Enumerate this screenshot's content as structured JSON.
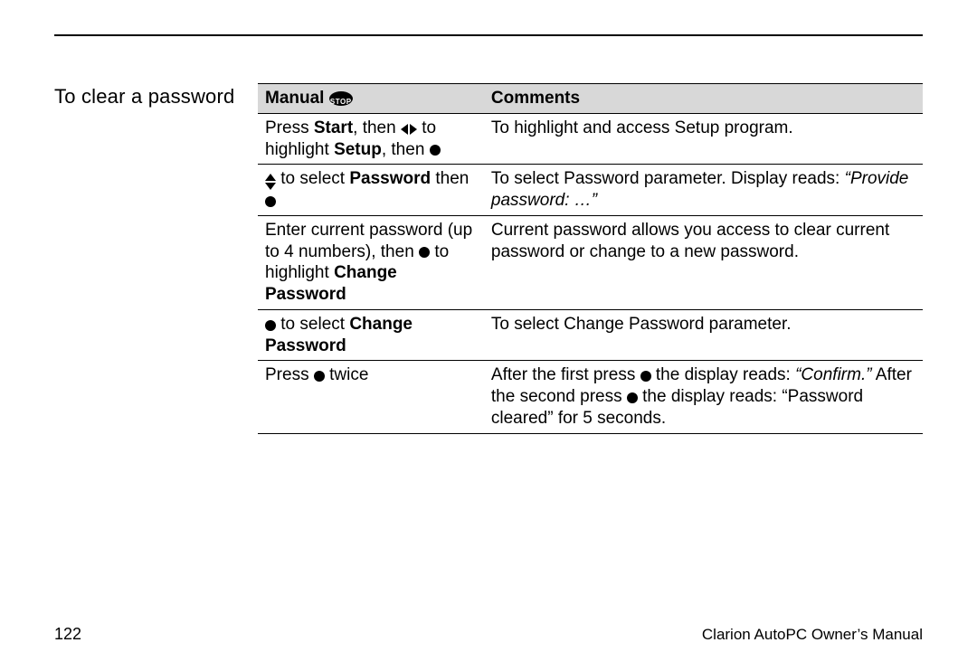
{
  "icons": {
    "stop_label": "STOP"
  },
  "sideHeading": "To clear a password",
  "headers": {
    "manual": "Manual",
    "comments": "Comments"
  },
  "rows": [
    {
      "manual": {
        "p1a": "Press ",
        "p1b": "Start",
        "p1c": ", then ",
        "p2a": " to highlight ",
        "p2b": "Setup",
        "p2c": ", then "
      },
      "comments": {
        "t1": "To highlight and access Setup program."
      }
    },
    {
      "manual": {
        "p1a": " to select ",
        "p1b": "Password",
        "p2a": " then "
      },
      "comments": {
        "t1": "To select Password parameter.  Display reads:  ",
        "i1": "“Provide password: …”"
      }
    },
    {
      "manual": {
        "p1a": "Enter current password (up to 4 numbers), then ",
        "p2a": " to highlight ",
        "p2b": "Change Password"
      },
      "comments": {
        "t1": "Current password allows you access to clear current password or change to a new password."
      }
    },
    {
      "manual": {
        "p1a": " to select ",
        "p1b": "Change Password"
      },
      "comments": {
        "t1": "To select Change Password parameter."
      }
    },
    {
      "manual": {
        "p1a": "Press ",
        "p1b": " twice"
      },
      "comments": {
        "t1": "After the first press ",
        "t2": " the display reads: ",
        "i1": "“Confirm.”",
        "t3": "  After the second press ",
        "t4": " the display reads:  “Password cleared” for 5 seconds."
      }
    }
  ],
  "pageNumber": "122",
  "footer": "Clarion AutoPC Owner’s Manual"
}
